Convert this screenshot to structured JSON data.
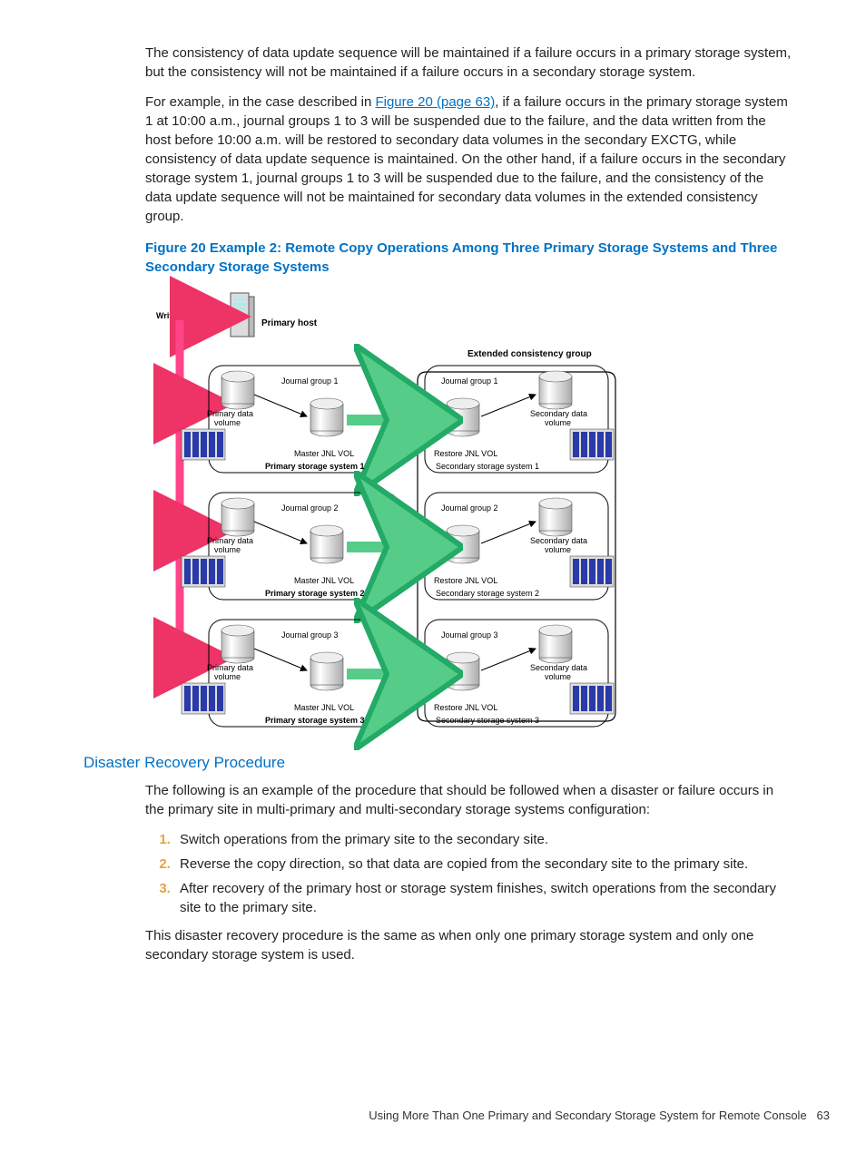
{
  "para1": "The consistency of data update sequence will be maintained if a failure occurs in a primary storage system, but the consistency will not be maintained if a failure occurs in a secondary storage system.",
  "para2a": "For example, in the case described in ",
  "para2link": "Figure 20 (page 63)",
  "para2b": ", if a failure occurs in the primary storage system 1 at 10:00 a.m., journal groups 1 to 3 will be suspended due to the failure, and the data written from the host before 10:00 a.m. will be restored to secondary data volumes in the secondary EXCTG, while consistency of data update sequence is maintained. On the other hand, if a failure occurs in the secondary storage system 1, journal groups 1 to 3 will be suspended due to the failure, and the consistency of the data update sequence will not be maintained for secondary data volumes in the extended consistency group.",
  "figcap": "Figure 20 Example 2: Remote Copy Operations Among Three Primary Storage Systems and Three Secondary Storage Systems",
  "diagram": {
    "write_data": "Write data",
    "primary_host": "Primary host",
    "ecg": "Extended consistency group",
    "journal_group": [
      "Journal group 1",
      "Journal group 2",
      "Journal group 3"
    ],
    "pdv": "Primary data volume",
    "sdv": "Secondary data volume",
    "master": "Master JNL VOL",
    "restore": "Restore JNL VOL",
    "pss": [
      "Primary storage system 1",
      "Primary storage system 2",
      "Primary storage system 3"
    ],
    "sss": [
      "Secondary storage system 1",
      "Secondary storage system 2",
      "Secondary storage system 3"
    ]
  },
  "section": "Disaster Recovery Procedure",
  "para3": "The following is an example of the procedure that should be followed when a disaster or failure occurs in the primary site in multi-primary and multi-secondary storage systems configuration:",
  "steps": [
    "Switch operations from the primary site to the secondary site.",
    "Reverse the copy direction, so that data are copied from the secondary site to the primary site.",
    "After recovery of the primary host or storage system finishes, switch operations from the secondary site to the primary site."
  ],
  "para4": "This disaster recovery procedure is the same as when only one primary storage system and only one secondary storage system is used.",
  "footer_text": "Using More Than One Primary and Secondary Storage System for Remote Console",
  "footer_page": "63"
}
